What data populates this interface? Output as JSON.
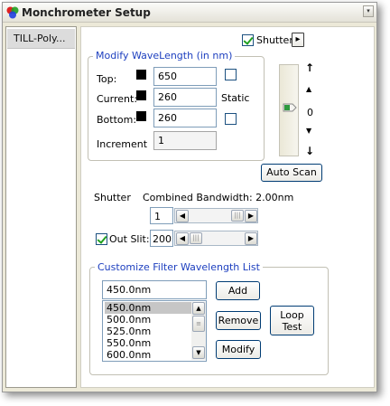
{
  "window": {
    "title": "Monchrometer Setup"
  },
  "sidebar": {
    "items": [
      {
        "label": "TILL-Poly..."
      }
    ]
  },
  "shutter_top": {
    "label": "Shutter",
    "checked": true,
    "toggle_glyph": "▸"
  },
  "wavelength": {
    "group_label": "Modify WaveLength (in nm)",
    "top": {
      "label": "Top:",
      "value": "650"
    },
    "current": {
      "label": "Current:",
      "value": "260"
    },
    "bottom": {
      "label": "Bottom:",
      "value": "260"
    },
    "static_label": "Static",
    "increment": {
      "label": "Increment",
      "value": "1"
    }
  },
  "stepper": {
    "value": "0",
    "up_fast": "↑",
    "up": "▲",
    "down": "▼",
    "down_fast": "↓"
  },
  "auto_scan_label": "Auto Scan",
  "bandwidth": {
    "shutter_label": "Shutter",
    "combined_label": "Combined Bandwidth: 2.00nm",
    "shutter_value": "1",
    "out_slit_label": "Out Slit:",
    "out_slit_checked": true,
    "out_slit_value": "200",
    "left_arrow": "◀",
    "right_arrow": "▶",
    "thumb_grip": "|||"
  },
  "filter": {
    "group_label": "Customize Filter Wavelength List",
    "input_value": "450.0nm",
    "items": [
      "450.0nm",
      "500.0nm",
      "525.0nm",
      "550.0nm",
      "600.0nm"
    ],
    "selected_index": 0,
    "add_label": "Add",
    "remove_label": "Remove",
    "modify_label": "Modify",
    "loop_label_line1": "Loop",
    "loop_label_line2": "Test"
  },
  "colors": {
    "group_label": "#1d3fbf",
    "slider_thumb": "#2e9a3e"
  }
}
